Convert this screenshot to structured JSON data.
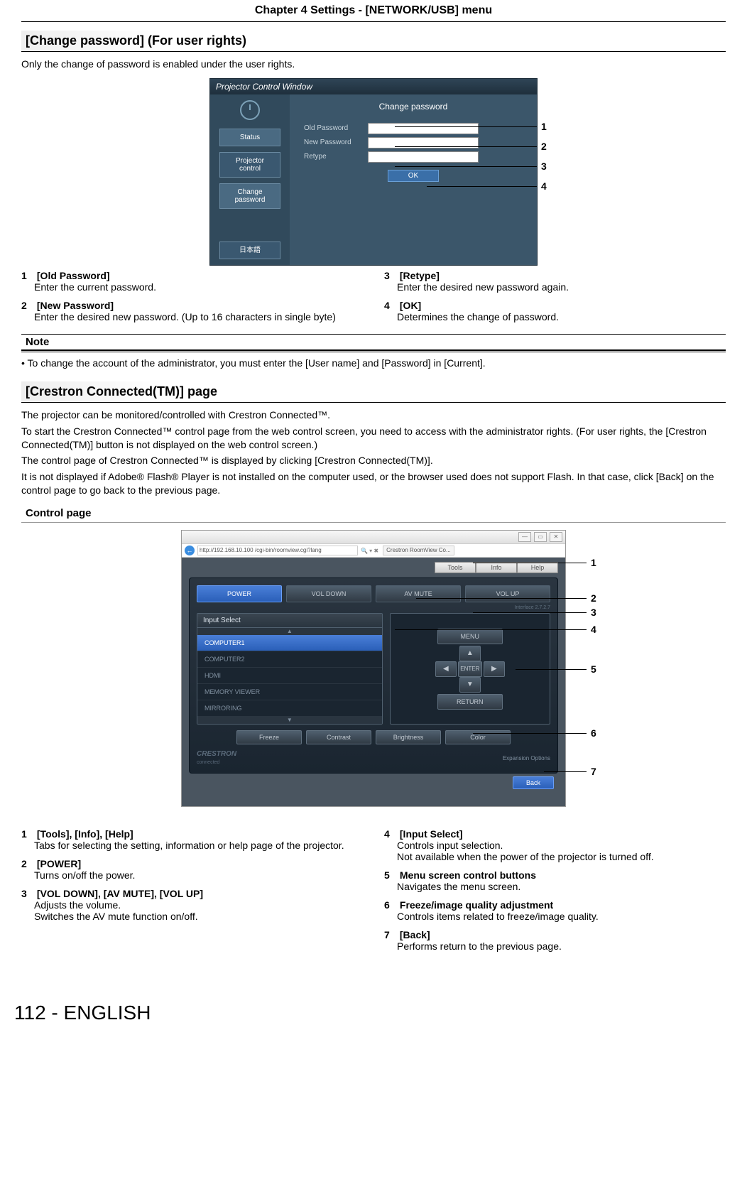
{
  "header": {
    "chapter": "Chapter 4   Settings - [NETWORK/USB] menu"
  },
  "section1": {
    "title": "[Change password] (For user rights)",
    "intro": "Only the change of password is enabled under the user rights."
  },
  "pcw": {
    "windowTitle": "Projector Control Window",
    "nav": {
      "status": "Status",
      "control1": "Projector",
      "control2": "control",
      "change1": "Change",
      "change2": "password",
      "jp": "日本語"
    },
    "mainTitle": "Change password",
    "labels": {
      "old": "Old Password",
      "new": "New Password",
      "retype": "Retype"
    },
    "ok": "OK"
  },
  "callouts1": {
    "c1": "1",
    "c2": "2",
    "c3": "3",
    "c4": "4"
  },
  "legend1": {
    "left": [
      {
        "n": "1",
        "t": "[Old Password]",
        "d": "Enter the current password."
      },
      {
        "n": "2",
        "t": "[New Password]",
        "d": "Enter the desired new password. (Up to 16 characters in single byte)"
      }
    ],
    "right": [
      {
        "n": "3",
        "t": "[Retype]",
        "d": "Enter the desired new password again."
      },
      {
        "n": "4",
        "t": "[OK]",
        "d": "Determines the change of password."
      }
    ]
  },
  "note": {
    "head": "Note",
    "bullet": "To change the account of the administrator, you must enter the [User name] and [Password] in [Current]."
  },
  "section2": {
    "title": "[Crestron Connected(TM)] page",
    "p1": "The projector can be monitored/controlled with Crestron Connected™.",
    "p2": "To start the Crestron Connected™ control page from the web control screen, you need to access with the administrator rights. (For user rights, the [Crestron Connected(TM)] button is not displayed on the web control screen.)",
    "p3": "The control page of Crestron Connected™ is displayed by clicking [Crestron Connected(TM)].",
    "p4": "It is not displayed if Adobe® Flash® Player is not installed on the computer used, or the browser used does not support Flash. In that case, click [Back] on the control page to go back to the previous page.",
    "subhead": "Control page"
  },
  "crv": {
    "url": "http://192.168.10.100 /cgi-bin/roomview.cgi?lang",
    "tabTitle": "Crestron RoomView Co...",
    "tabs": {
      "tools": "Tools",
      "info": "Info",
      "help": "Help"
    },
    "btns": {
      "power": "POWER",
      "voldown": "VOL DOWN",
      "avmute": "AV MUTE",
      "volup": "VOL UP"
    },
    "interface": "Interface 2.7.2.7",
    "inputSelect": {
      "label": "Input Select",
      "items": [
        "COMPUTER1",
        "COMPUTER2",
        "HDMI",
        "MEMORY VIEWER",
        "MIRRORING"
      ]
    },
    "menu": {
      "menu": "MENU",
      "enter": "ENTER",
      "return": "RETURN",
      "up": "▲",
      "down": "▼",
      "left": "◀",
      "right": "▶"
    },
    "bottom": [
      "Freeze",
      "Contrast",
      "Brightness",
      "Color"
    ],
    "logo": "CRESTRON",
    "connected": "connected",
    "expansion": "Expansion Options",
    "back": "Back"
  },
  "callouts2": {
    "c1": "1",
    "c2": "2",
    "c3": "3",
    "c4": "4",
    "c5": "5",
    "c6": "6",
    "c7": "7"
  },
  "legend2": {
    "left": [
      {
        "n": "1",
        "t": "[Tools], [Info], [Help]",
        "d": "Tabs for selecting the setting, information or help page of the projector."
      },
      {
        "n": "2",
        "t": "[POWER]",
        "d": "Turns on/off the power."
      },
      {
        "n": "3",
        "t": "[VOL DOWN], [AV MUTE], [VOL UP]",
        "d": "Adjusts the volume.\nSwitches the AV mute function on/off."
      }
    ],
    "right": [
      {
        "n": "4",
        "t": "[Input Select]",
        "d": "Controls input selection.\nNot available when the power of the projector is turned off."
      },
      {
        "n": "5",
        "t": "Menu screen control buttons",
        "d": "Navigates the menu screen."
      },
      {
        "n": "6",
        "t": "Freeze/image quality adjustment",
        "d": "Controls items related to freeze/image quality."
      },
      {
        "n": "7",
        "t": "[Back]",
        "d": "Performs return to the previous page."
      }
    ]
  },
  "footer": "112 - ENGLISH"
}
